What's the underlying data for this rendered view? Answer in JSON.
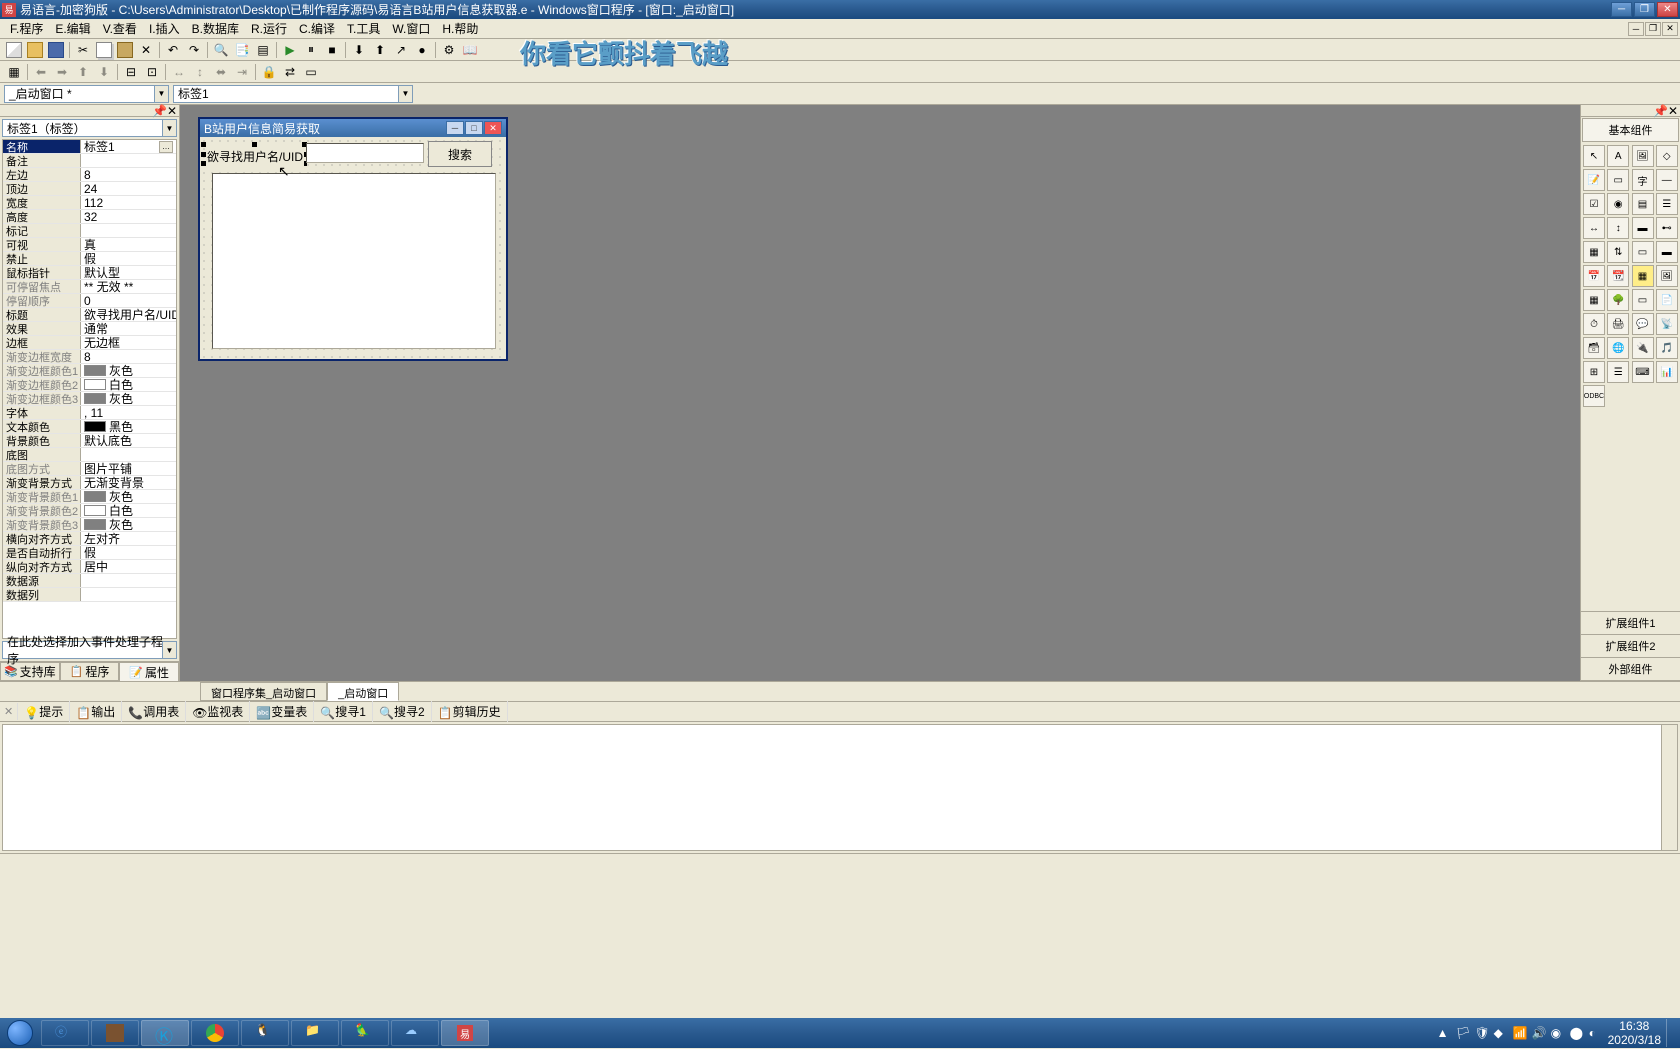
{
  "titlebar": {
    "text": "易语言-加密狗版 - C:\\Users\\Administrator\\Desktop\\已制作程序源码\\易语言B站用户信息获取器.e - Windows窗口程序 - [窗口:_启动窗口]"
  },
  "menu": {
    "items": [
      "F.程序",
      "E.编辑",
      "V.查看",
      "I.插入",
      "B.数据库",
      "R.运行",
      "C.编译",
      "T.工具",
      "W.窗口",
      "H.帮助"
    ]
  },
  "decorative_text": "你看它颤抖着飞越",
  "dropdowns": {
    "window_combo": "_启动窗口 *",
    "control_combo": "标签1"
  },
  "left_panel": {
    "object_combo": "标签1（标签）",
    "event_combo": "在此处选择加入事件处理子程序",
    "tabs": {
      "support": "支持库",
      "program": "程序",
      "property": "属性"
    }
  },
  "properties": [
    {
      "name": "名称",
      "value": "标签1",
      "selected": true,
      "has_btn": true
    },
    {
      "name": "备注",
      "value": ""
    },
    {
      "name": "左边",
      "value": "8"
    },
    {
      "name": "顶边",
      "value": "24"
    },
    {
      "name": "宽度",
      "value": "112"
    },
    {
      "name": "高度",
      "value": "32"
    },
    {
      "name": "标记",
      "value": ""
    },
    {
      "name": "可视",
      "value": "真"
    },
    {
      "name": "禁止",
      "value": "假"
    },
    {
      "name": "鼠标指针",
      "value": "默认型"
    },
    {
      "name": "可停留焦点",
      "value": "** 无效 **",
      "sub": true
    },
    {
      "name": "停留顺序",
      "value": "0",
      "sub": true
    },
    {
      "name": "标题",
      "value": "欲寻找用户名/UID"
    },
    {
      "name": "效果",
      "value": "通常"
    },
    {
      "name": "边框",
      "value": "无边框"
    },
    {
      "name": "渐变边框宽度",
      "value": "8",
      "sub": true
    },
    {
      "name": "渐变边框颜色1",
      "value": "灰色",
      "color": "#808080",
      "sub": true
    },
    {
      "name": "渐变边框颜色2",
      "value": "白色",
      "color": "#ffffff",
      "sub": true
    },
    {
      "name": "渐变边框颜色3",
      "value": "灰色",
      "color": "#808080",
      "sub": true
    },
    {
      "name": "字体",
      "value": ", 11"
    },
    {
      "name": "文本颜色",
      "value": "黑色",
      "color": "#000000"
    },
    {
      "name": "背景颜色",
      "value": "默认底色"
    },
    {
      "name": "底图",
      "value": ""
    },
    {
      "name": "底图方式",
      "value": "图片平铺",
      "sub": true
    },
    {
      "name": "渐变背景方式",
      "value": "无渐变背景"
    },
    {
      "name": "渐变背景颜色1",
      "value": "灰色",
      "color": "#808080",
      "sub": true
    },
    {
      "name": "渐变背景颜色2",
      "value": "白色",
      "color": "#ffffff",
      "sub": true
    },
    {
      "name": "渐变背景颜色3",
      "value": "灰色",
      "color": "#808080",
      "sub": true
    },
    {
      "name": "横向对齐方式",
      "value": "左对齐"
    },
    {
      "name": "是否自动折行",
      "value": "假"
    },
    {
      "name": "纵向对齐方式",
      "value": "居中"
    },
    {
      "name": "数据源",
      "value": ""
    },
    {
      "name": "数据列",
      "value": ""
    }
  ],
  "center": {
    "tabs": {
      "collection": "窗口程序集_启动窗口",
      "window": "_启动窗口"
    }
  },
  "mock_window": {
    "title": "B站用户信息简易获取",
    "label": "欲寻找用户名/UID",
    "button": "搜索"
  },
  "right_panel": {
    "title": "基本组件",
    "footer": [
      "扩展组件1",
      "扩展组件2",
      "外部组件"
    ]
  },
  "bottom_panel": {
    "tabs": [
      "提示",
      "输出",
      "调用表",
      "监视表",
      "变量表",
      "搜寻1",
      "搜寻2",
      "剪辑历史"
    ]
  },
  "taskbar": {
    "time": "16:38",
    "date": "2020/3/18"
  }
}
